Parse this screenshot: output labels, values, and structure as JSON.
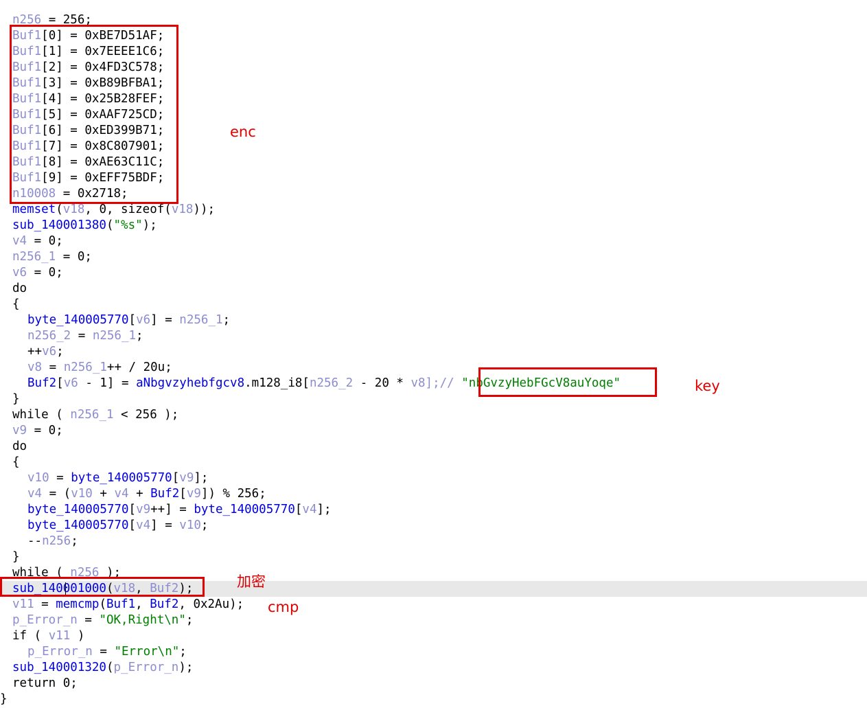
{
  "code": {
    "line0": [
      "n256",
      " = ",
      "256;"
    ],
    "buf": [
      [
        "Buf1",
        "[0]",
        " = ",
        "0xBE7D51AF;"
      ],
      [
        "Buf1",
        "[1]",
        " = ",
        "0x7EEEE1C6;"
      ],
      [
        "Buf1",
        "[2]",
        " = ",
        "0x4FD3C578;"
      ],
      [
        "Buf1",
        "[3]",
        " = ",
        "0xB89BFBA1;"
      ],
      [
        "Buf1",
        "[4]",
        " = ",
        "0x25B28FEF;"
      ],
      [
        "Buf1",
        "[5]",
        " = ",
        "0xAAF725CD;"
      ],
      [
        "Buf1",
        "[6]",
        " = ",
        "0xED399B71;"
      ],
      [
        "Buf1",
        "[7]",
        " = ",
        "0x8C807901;"
      ],
      [
        "Buf1",
        "[8]",
        " = ",
        "0xAE63C11C;"
      ],
      [
        "Buf1",
        "[9]",
        " = ",
        "0xEFF75BDF;"
      ]
    ],
    "n10008": [
      "n10008",
      " = ",
      "0x2718;"
    ],
    "memset": [
      "memset",
      "(",
      "v18",
      ", 0, sizeof(",
      "v18",
      "));"
    ],
    "sub1380": [
      "sub_140001380",
      "(",
      "\"%s\"",
      ");"
    ],
    "v4": [
      "v4",
      " = 0;"
    ],
    "n256_1_init": [
      "n256_1",
      " = 0;"
    ],
    "v6": [
      "v6",
      " = 0;"
    ],
    "do1": "do",
    "open1": "{",
    "byte_line": [
      "byte_140005770",
      "[",
      "v6",
      "] = ",
      "n256_1",
      ";"
    ],
    "n256_2_line": [
      "n256_2",
      " = ",
      "n256_1",
      ";"
    ],
    "incv6": [
      "++",
      "v6",
      ";"
    ],
    "v8_line": [
      "v8",
      " = ",
      "n256_1",
      "++ / 20u;"
    ],
    "buf2_line": [
      "Buf2",
      "[",
      "v6",
      " - 1] = ",
      "aNbgvzyhebfgcv8",
      ".m128_i8[",
      "n256_2",
      " - 20 * ",
      "v8",
      "];// ",
      "\"nbGvzyHebFGcV8auYoqe\""
    ],
    "close1": "}",
    "while1": [
      "while ( ",
      "n256_1",
      " < 256 );"
    ],
    "v9": [
      "v9",
      " = 0;"
    ],
    "do2": "do",
    "open2": "{",
    "v10_line": [
      "v10",
      " = ",
      "byte_140005770",
      "[",
      "v9",
      "];"
    ],
    "v4_line": [
      "v4",
      " = (",
      "v10",
      " + ",
      "v4",
      " + ",
      "Buf2",
      "[",
      "v9",
      "]) % 256;"
    ],
    "swap1": [
      "byte_140005770",
      "[",
      "v9",
      "++] = ",
      "byte_140005770",
      "[",
      "v4",
      "];"
    ],
    "swap2": [
      "byte_140005770",
      "[",
      "v4",
      "] = ",
      "v10",
      ";"
    ],
    "dec": [
      "--",
      "n256",
      ";"
    ],
    "close2": "}",
    "while2": [
      "while ( ",
      "n256",
      " );"
    ],
    "sub1000": [
      "sub_140001000",
      "(",
      "v18",
      ", ",
      "Buf2",
      ");"
    ],
    "memcmp": [
      "v11",
      " = ",
      "memcmp",
      "(",
      "Buf1",
      ", ",
      "Buf2",
      ", 0x2Au);"
    ],
    "perr1": [
      "p_Error_n",
      " = ",
      "\"OK,Right\\n\"",
      ";"
    ],
    "if_line": [
      "if ( ",
      "v11",
      " )"
    ],
    "perr2": [
      "p_Error_n",
      " = ",
      "\"Error\\n\"",
      ";"
    ],
    "sub1320": [
      "sub_140001320",
      "(",
      "p_Error_n",
      ");"
    ],
    "ret": "return 0;",
    "final_brace": "}"
  },
  "annotations": {
    "enc": "enc",
    "key": "key",
    "encrypt": "加密",
    "cmp": "cmp"
  },
  "colors": {
    "variable": "#8c8cd0",
    "function": "#0000e6",
    "string": "#008000",
    "annotation": "#e00000",
    "current_line": "#e8e8e8"
  }
}
